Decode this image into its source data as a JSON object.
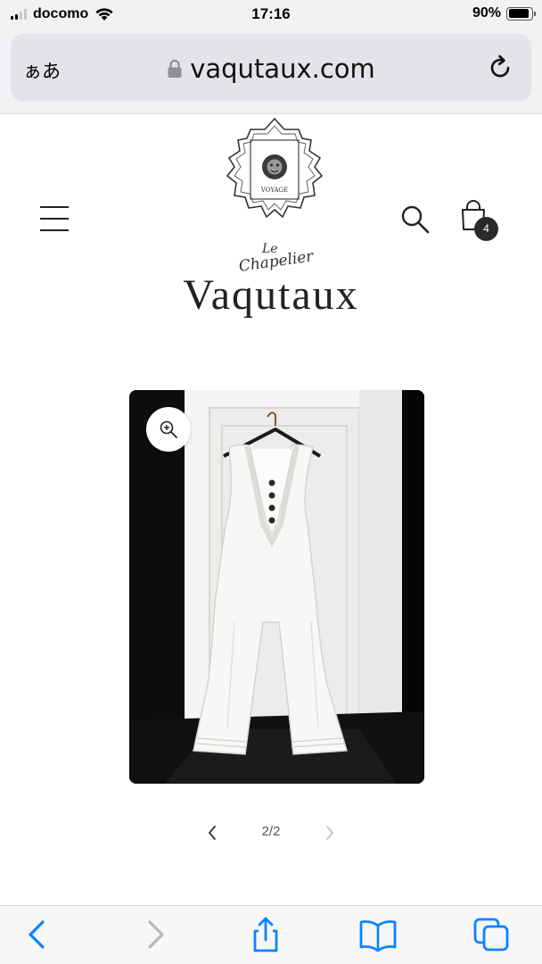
{
  "status_bar": {
    "carrier": "docomo",
    "time": "17:16",
    "battery_percent": "90%",
    "battery_level": 0.9,
    "signal_bars": 2
  },
  "browser": {
    "text_size_label": "ぁあ",
    "url": "vaqutaux.com",
    "lock_icon": "lock-icon",
    "reload_icon": "reload-icon"
  },
  "site": {
    "emblem_text": "VOYAGE",
    "logo_le": "Le",
    "logo_chapelier": "Chapelier",
    "logo_name": "Vaqutaux",
    "menu_icon": "hamburger-menu-icon",
    "search_icon": "search-icon",
    "cart_icon": "shopping-bag-icon",
    "cart_count": "4"
  },
  "product": {
    "zoom_icon": "zoom-in-icon",
    "pager_text": "2/2",
    "current_page": 2,
    "total_pages": 2
  },
  "toolbar": {
    "items": [
      "back-icon",
      "forward-icon",
      "share-icon",
      "bookmarks-icon",
      "tabs-icon"
    ]
  },
  "colors": {
    "accent_blue": "#0a84ff",
    "disabled_gray": "#b8b8bd",
    "badge_bg": "#2a2a2a"
  }
}
